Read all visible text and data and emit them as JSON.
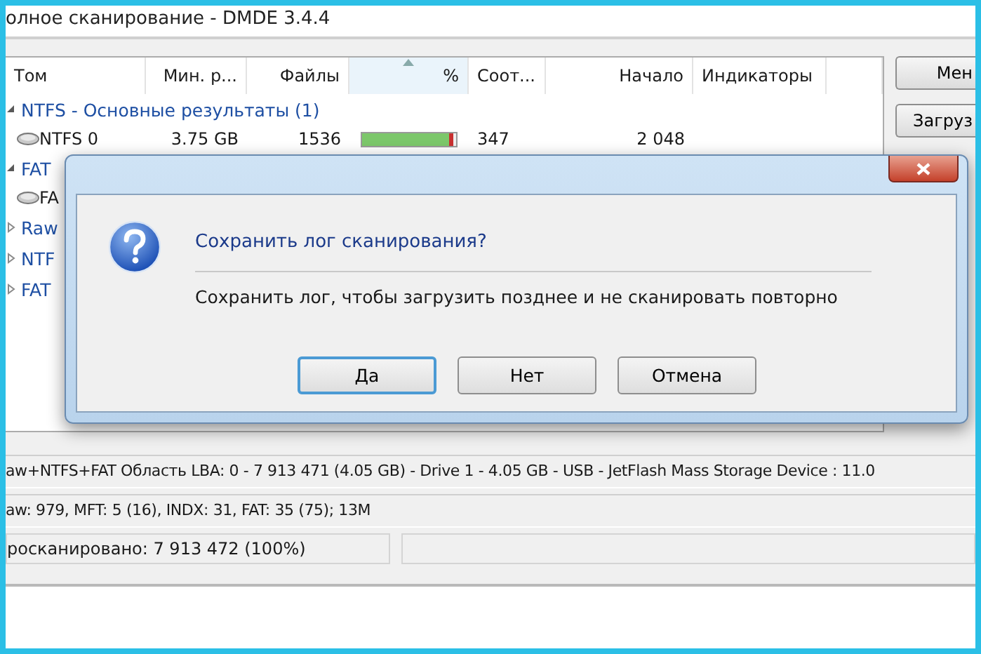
{
  "window": {
    "title": "олное сканирование - DMDE 3.4.4"
  },
  "table": {
    "columns": [
      {
        "label": "Том"
      },
      {
        "label": "Мин. р..."
      },
      {
        "label": "Файлы"
      },
      {
        "label": "%",
        "sorted": true
      },
      {
        "label": "Соот..."
      },
      {
        "label": "Начало"
      },
      {
        "label": "Индикаторы"
      }
    ],
    "rows": [
      {
        "kind": "group",
        "label": "NTFS - Основные результаты (1)",
        "expanded": true
      },
      {
        "kind": "volume",
        "cells": [
          "NTFS 0",
          "3.75 GB",
          "1536",
          "",
          "347",
          "2 048"
        ],
        "level": 0.93
      },
      {
        "kind": "group",
        "label": "FAT",
        "expanded": true
      },
      {
        "kind": "volume",
        "cells": [
          "FA"
        ]
      },
      {
        "kind": "group",
        "label": "Raw",
        "expanded": false
      },
      {
        "kind": "group",
        "label": "NTF",
        "expanded": false
      },
      {
        "kind": "group",
        "label": "FAT",
        "expanded": false
      }
    ]
  },
  "side_buttons": [
    "Мен",
    "Загруз"
  ],
  "dialog": {
    "message": "Сохранить лог сканирования?",
    "detail": "Сохранить лог, чтобы загрузить позднее и не сканировать повторно",
    "buttons": [
      {
        "label": "Да",
        "default": true
      },
      {
        "label": "Нет",
        "default": false
      },
      {
        "label": "Отмена",
        "default": false
      }
    ]
  },
  "status_bar": {
    "lines": [
      "aw+NTFS+FAT Область LBA: 0 - 7 913 471 (4.05 GB) - Drive 1 - 4.05 GB - USB - JetFlash Mass Storage Device : 11.0",
      "aw: 979, MFT: 5 (16), INDX: 31, FAT: 35 (75); 13M"
    ],
    "progress_text": "росканировано: 7 913 472 (100%)"
  }
}
